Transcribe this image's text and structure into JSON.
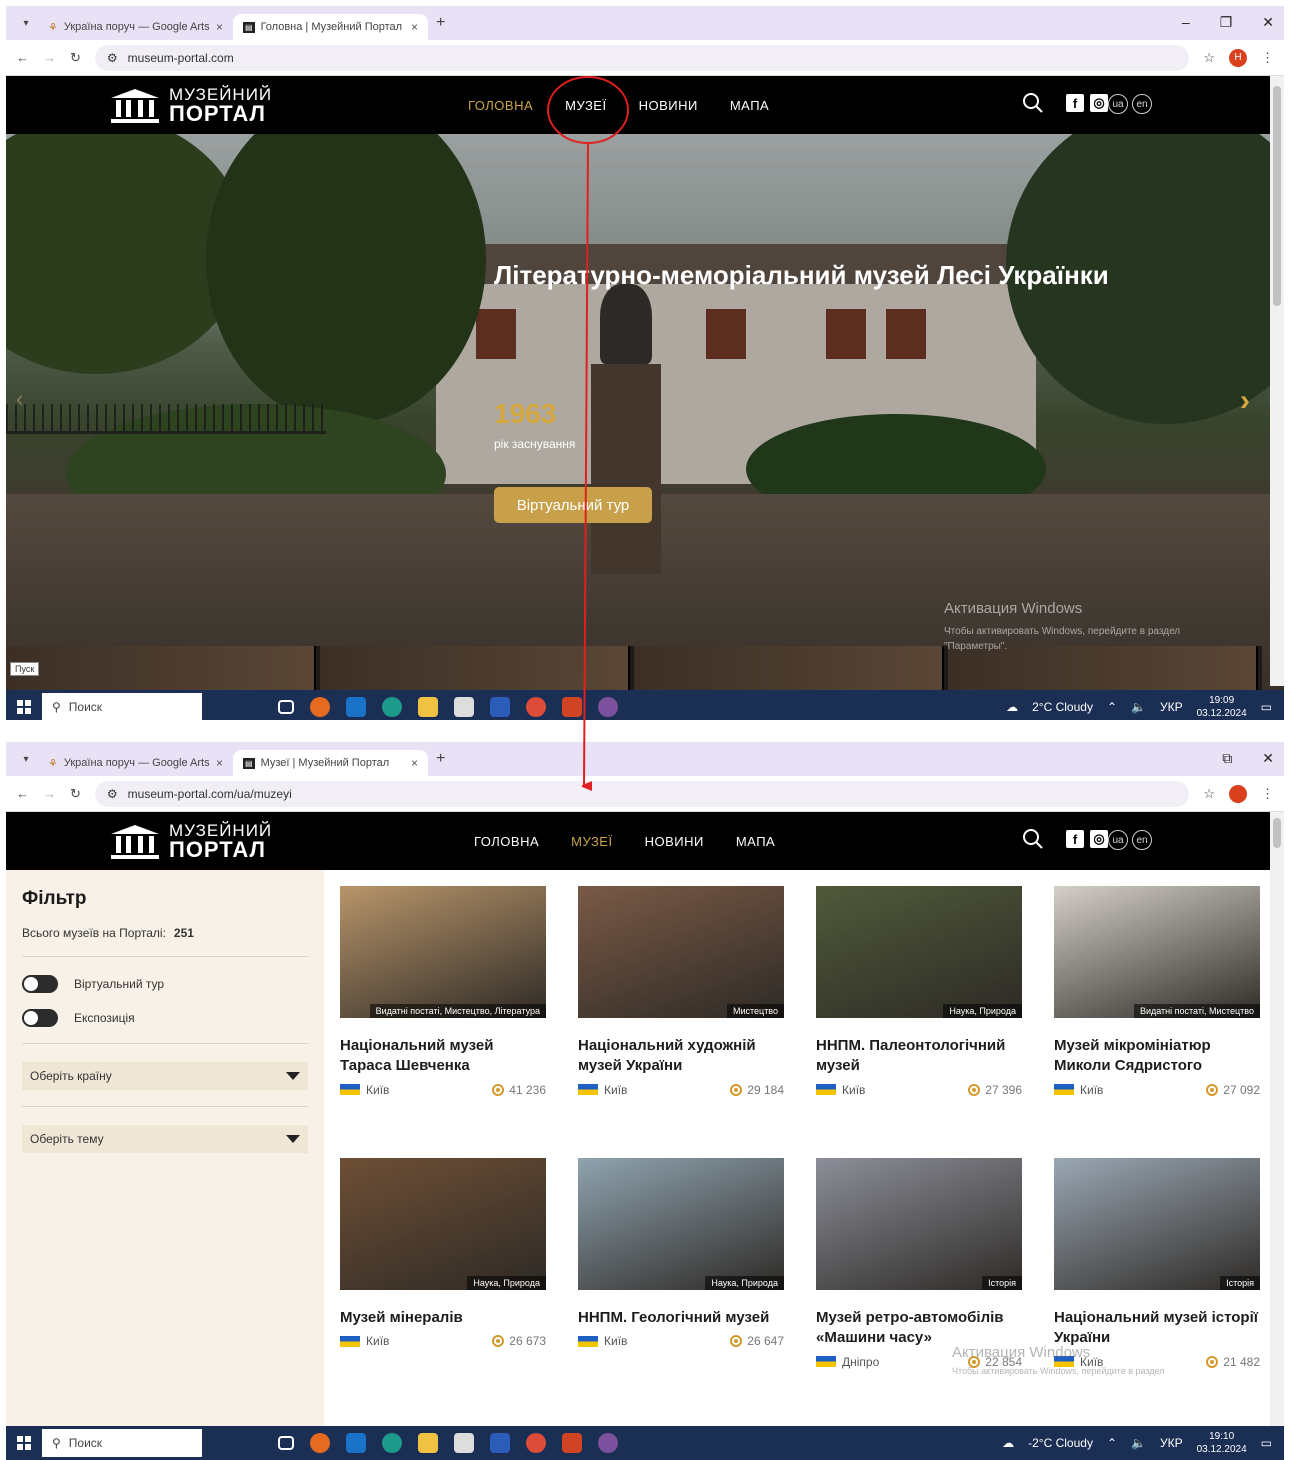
{
  "screen1": {
    "tabs": [
      {
        "title": "Україна поруч — Google Arts",
        "close": "×"
      },
      {
        "title": "Головна | Музейний Портал",
        "close": "×"
      }
    ],
    "new_tab": "+",
    "url": "museum-portal.com",
    "profile_letter": "Н",
    "site": {
      "logo_line1": "МУЗЕЙНИЙ",
      "logo_line2": "ПОРТАЛ",
      "nav": [
        "ГОЛОВНА",
        "МУЗЕЇ",
        "НОВИНИ",
        "МАПА"
      ],
      "active_nav": "ГОЛОВНА",
      "langs": [
        "ua",
        "en"
      ]
    },
    "hero": {
      "title": "Літературно-меморіальний музей Лесі Українки",
      "year": "1963",
      "year_label": "рік заснування",
      "button": "Віртуальний тур",
      "next_arrow": "›",
      "prev_arrow": "‹"
    },
    "watermark_title": "Активация Windows",
    "watermark_text": "Чтобы активировать Windows, перейдите в раздел \"Параметры\".",
    "start_tooltip": "Пуск",
    "taskbar": {
      "search": "Поиск",
      "weather": "2°C Cloudy",
      "lang": "УКР",
      "time": "19:09",
      "date": "03.12.2024"
    }
  },
  "screen2": {
    "tabs": [
      {
        "title": "Україна поруч — Google Arts",
        "close": "×"
      },
      {
        "title": "Музеї | Музейний Портал",
        "close": "×"
      }
    ],
    "new_tab": "+",
    "url": "museum-portal.com/ua/muzeyi",
    "site": {
      "logo_line1": "МУЗЕЙНИЙ",
      "logo_line2": "ПОРТАЛ",
      "nav": [
        "ГОЛОВНА",
        "МУЗЕЇ",
        "НОВИНИ",
        "МАПА"
      ],
      "active_nav": "МУЗЕЇ",
      "langs": [
        "ua",
        "en"
      ]
    },
    "filter": {
      "title": "Фільтр",
      "count_label": "Всього музеїв на Порталі:",
      "count": "251",
      "toggle_virtual": "Віртуальний тур",
      "toggle_expo": "Експозиція",
      "country_placeholder": "Оберіть країну",
      "theme_placeholder": "Оберіть тему"
    },
    "museums": [
      {
        "name": "Національний музей Тараса Шевченка",
        "city": "Київ",
        "views": "41 236",
        "tags": "Видатні постаті, Мистецтво, Література",
        "color": "#b8956a"
      },
      {
        "name": "Національний художній музей України",
        "city": "Київ",
        "views": "29 184",
        "tags": "Мистецтво",
        "color": "#7a5a46"
      },
      {
        "name": "ННПМ. Палеонтологічний музей",
        "city": "Київ",
        "views": "27 396",
        "tags": "Наука, Природа",
        "color": "#4f5a3a"
      },
      {
        "name": "Музей мікромініатюр Миколи Сядристого",
        "city": "Київ",
        "views": "27 092",
        "tags": "Видатні постаті, Мистецтво",
        "color": "#d4d0c8"
      },
      {
        "name": "Музей мінералів",
        "city": "Київ",
        "views": "26 673",
        "tags": "Наука, Природа",
        "color": "#6e4f35"
      },
      {
        "name": "ННПМ. Геологічний музей",
        "city": "Київ",
        "views": "26 647",
        "tags": "Наука, Природа",
        "color": "#8fa3b0"
      },
      {
        "name": "Музей ретро-автомобілів «Машини часу»",
        "city": "Дніпро",
        "views": "22 854",
        "tags": "Історія",
        "color": "#8c8f99"
      },
      {
        "name": "Національний музей історії України",
        "city": "Київ",
        "views": "21 482",
        "tags": "Історія",
        "color": "#9aa7b4"
      }
    ],
    "watermark_title": "Активация Windows",
    "watermark_text": "Чтобы активировать Windows, перейдите в раздел",
    "taskbar": {
      "search": "Поиск",
      "weather": "-2°C Cloudy",
      "lang": "УКР",
      "time": "19:10",
      "date": "03.12.2024"
    }
  },
  "annotation": {
    "color": "#e02020"
  }
}
